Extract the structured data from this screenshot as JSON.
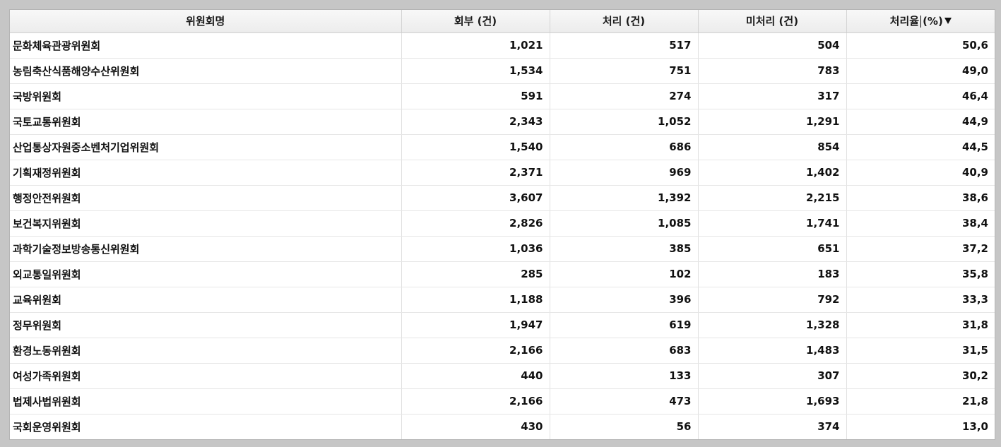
{
  "table": {
    "headers": {
      "committee": "위원회명",
      "referred": "회부 (건)",
      "processed": "처리 (건)",
      "pending": "미처리 (건)",
      "rate_main": "처리율",
      "rate_unit": "(%)"
    },
    "sort_icon": "sort-descending-icon",
    "rows": [
      {
        "committee": "문화체육관광위원회",
        "referred": "1,021",
        "processed": "517",
        "pending": "504",
        "rate": "50,6"
      },
      {
        "committee": "농림축산식품해양수산위원회",
        "referred": "1,534",
        "processed": "751",
        "pending": "783",
        "rate": "49,0"
      },
      {
        "committee": "국방위원회",
        "referred": "591",
        "processed": "274",
        "pending": "317",
        "rate": "46,4"
      },
      {
        "committee": "국토교통위원회",
        "referred": "2,343",
        "processed": "1,052",
        "pending": "1,291",
        "rate": "44,9"
      },
      {
        "committee": "산업통상자원중소벤처기업위원회",
        "referred": "1,540",
        "processed": "686",
        "pending": "854",
        "rate": "44,5"
      },
      {
        "committee": "기획재정위원회",
        "referred": "2,371",
        "processed": "969",
        "pending": "1,402",
        "rate": "40,9"
      },
      {
        "committee": "행정안전위원회",
        "referred": "3,607",
        "processed": "1,392",
        "pending": "2,215",
        "rate": "38,6"
      },
      {
        "committee": "보건복지위원회",
        "referred": "2,826",
        "processed": "1,085",
        "pending": "1,741",
        "rate": "38,4"
      },
      {
        "committee": "과학기술정보방송통신위원회",
        "referred": "1,036",
        "processed": "385",
        "pending": "651",
        "rate": "37,2"
      },
      {
        "committee": "외교통일위원회",
        "referred": "285",
        "processed": "102",
        "pending": "183",
        "rate": "35,8"
      },
      {
        "committee": "교육위원회",
        "referred": "1,188",
        "processed": "396",
        "pending": "792",
        "rate": "33,3"
      },
      {
        "committee": "정무위원회",
        "referred": "1,947",
        "processed": "619",
        "pending": "1,328",
        "rate": "31,8"
      },
      {
        "committee": "환경노동위원회",
        "referred": "2,166",
        "processed": "683",
        "pending": "1,483",
        "rate": "31,5"
      },
      {
        "committee": "여성가족위원회",
        "referred": "440",
        "processed": "133",
        "pending": "307",
        "rate": "30,2"
      },
      {
        "committee": "법제사법위원회",
        "referred": "2,166",
        "processed": "473",
        "pending": "1,693",
        "rate": "21,8"
      },
      {
        "committee": "국회운영위원회",
        "referred": "430",
        "processed": "56",
        "pending": "374",
        "rate": "13,0"
      }
    ]
  }
}
